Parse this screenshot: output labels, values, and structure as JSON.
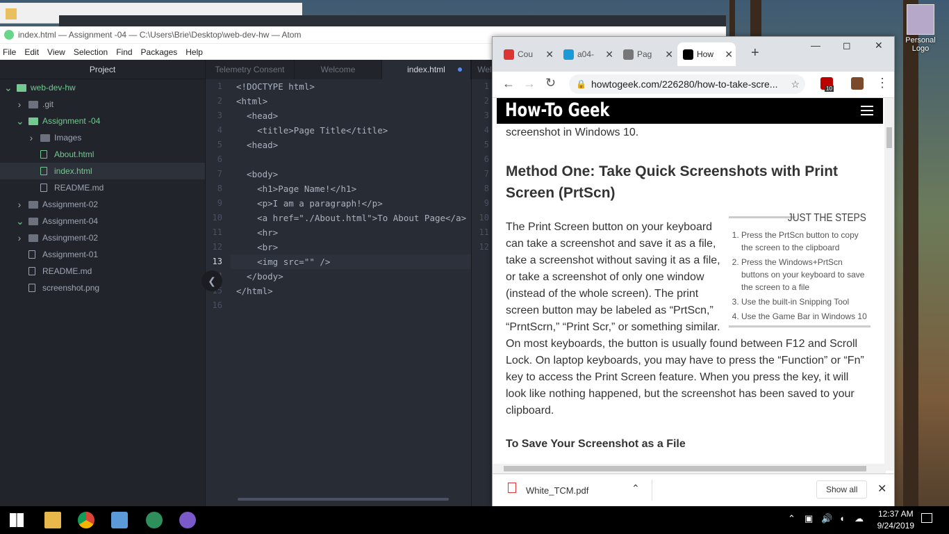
{
  "desktop": {
    "icon_label": "Personal Logo"
  },
  "atom": {
    "title": "index.html — Assignment -04 — C:\\Users\\Brie\\Desktop\\web-dev-hw — Atom",
    "menu": [
      "File",
      "Edit",
      "View",
      "Selection",
      "Find",
      "Packages",
      "Help"
    ],
    "project_title": "Project",
    "tree": [
      {
        "label": "web-dev-hw",
        "type": "repo",
        "open": true,
        "indent": 0
      },
      {
        "label": ".git",
        "type": "folder",
        "open": false,
        "indent": 1
      },
      {
        "label": "Assignment -04",
        "type": "folder",
        "open": true,
        "indent": 1
      },
      {
        "label": "Images",
        "type": "folder",
        "open": false,
        "indent": 2
      },
      {
        "label": "About.html",
        "type": "file",
        "indent": 2
      },
      {
        "label": "index.html",
        "type": "file",
        "indent": 2
      },
      {
        "label": "README.md",
        "type": "book",
        "indent": 2
      },
      {
        "label": "Assignment-02",
        "type": "folder",
        "open": false,
        "indent": 1
      },
      {
        "label": "Assignment-04",
        "type": "folder",
        "open": true,
        "indent": 1
      },
      {
        "label": "Assingment-02",
        "type": "folder",
        "open": false,
        "indent": 1
      },
      {
        "label": "Assignment-01",
        "type": "plainfile",
        "indent": 1
      },
      {
        "label": "README.md",
        "type": "book",
        "indent": 1
      },
      {
        "label": "screenshot.png",
        "type": "image",
        "indent": 1
      }
    ],
    "tabs": [
      "Telemetry Consent",
      "Welcome",
      "index.html",
      "Wel"
    ],
    "line_numbers": [
      "1",
      "2",
      "3",
      "4",
      "5",
      "6",
      "7",
      "8",
      "9",
      "10",
      "11",
      "12",
      "13",
      "14",
      "15",
      "16"
    ],
    "code": [
      "<!DOCTYPE html>",
      "<html>",
      "  <head>",
      "    <title>Page Title</title>",
      "  <head>",
      "",
      "  <body>",
      "    <h1>Page Name!</h1>",
      "    <p>I am a paragraph!</p>",
      "    <a href=\"./About.html\">To About Page</a>",
      "    <hr>",
      "    <br>",
      "    <img src=\"\" />",
      "  </body>",
      "</html>",
      ""
    ],
    "gutter2": [
      "1",
      "2",
      "3",
      "4",
      "5",
      "6",
      "7",
      "8",
      "9",
      "10",
      "11",
      "12"
    ]
  },
  "chrome": {
    "tabs": [
      {
        "label": "Cou",
        "color": "#d33"
      },
      {
        "label": "a04-",
        "color": "#1a9bd7"
      },
      {
        "label": "Pag",
        "color": "#777"
      },
      {
        "label": "How",
        "color": "#000"
      }
    ],
    "url": "howtogeek.com/226280/how-to-take-scre...",
    "site_name": "How-To Geek",
    "ext_badge": "10",
    "intro": "screenshot in Windows 10.",
    "heading": "Method One: Take Quick Screenshots with Print Screen (PrtScn)",
    "steps_title": "JUST THE STEPS",
    "steps": [
      "Press the PrtScn button to copy the screen to the clipboard",
      "Press the Windows+PrtScn buttons on your keyboard to save the screen to a file",
      "Use the built-in Snipping Tool",
      "Use the Game Bar in Windows 10"
    ],
    "paragraph": "The Print Screen button on your keyboard can take a screenshot and save it as a file, take a screenshot without saving it as a file, or take a screenshot of only one window (instead of the whole screen). The print screen button may be labeled as “PrtScn,” “PrntScrn,” “Print Scr,” or something similar. On most keyboards, the button is usually found between F12 and Scroll Lock. On laptop keyboards, you may have to press the “Function” or “Fn” key to access the Print Screen feature. When you press the key, it will look like nothing happened, but the screenshot has been saved to your clipboard.",
    "subheading": "To Save Your Screenshot as a File",
    "download": "White_TCM.pdf",
    "show_all": "Show all"
  },
  "taskbar": {
    "time": "12:37 AM",
    "date": "9/24/2019"
  }
}
